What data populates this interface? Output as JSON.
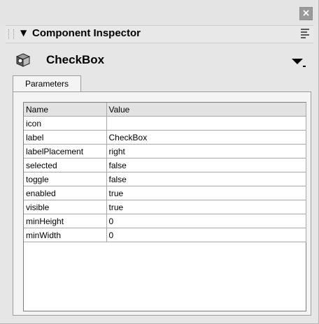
{
  "panel": {
    "title": "Component Inspector",
    "collapse_glyph": "▼",
    "close_glyph": "×"
  },
  "component": {
    "name": "CheckBox",
    "icon": "component-cube-icon"
  },
  "tabs": [
    {
      "label": "Parameters",
      "active": true
    }
  ],
  "grid": {
    "columns": [
      "Name",
      "Value"
    ],
    "rows": [
      {
        "name": "icon",
        "value": ""
      },
      {
        "name": "label",
        "value": "CheckBox"
      },
      {
        "name": "labelPlacement",
        "value": "right"
      },
      {
        "name": "selected",
        "value": "false"
      },
      {
        "name": "toggle",
        "value": "false"
      },
      {
        "name": "enabled",
        "value": "true"
      },
      {
        "name": "visible",
        "value": "true"
      },
      {
        "name": "minHeight",
        "value": "0"
      },
      {
        "name": "minWidth",
        "value": "0"
      }
    ]
  }
}
